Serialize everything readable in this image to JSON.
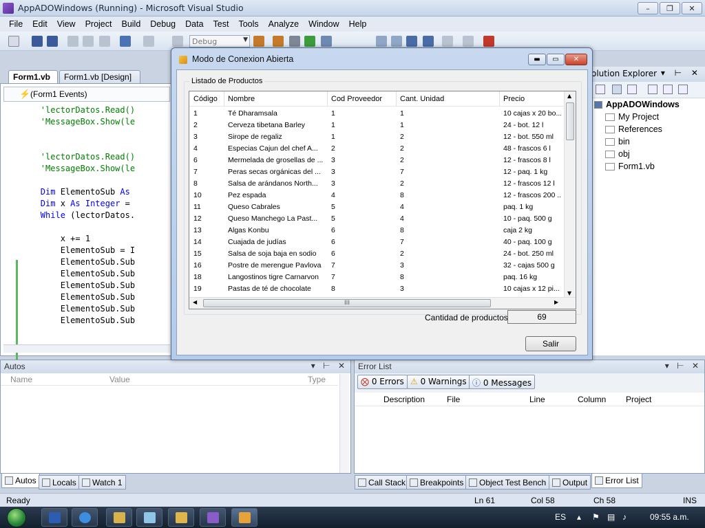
{
  "window": {
    "title": "AppADOWindows (Running) - Microsoft Visual Studio",
    "min": "–",
    "max": "❐",
    "close": "✕"
  },
  "menu": [
    "File",
    "Edit",
    "View",
    "Project",
    "Build",
    "Debug",
    "Data",
    "Test",
    "Tools",
    "Analyze",
    "Window",
    "Help"
  ],
  "toolbar": {
    "config": "Debug"
  },
  "tabs": {
    "code": "Form1.vb",
    "design": "Form1.vb [Design]"
  },
  "editor": {
    "events": "(Form1 Events)",
    "lines": [
      {
        "parts": [
          {
            "t": "        'lectorDatos.Read()",
            "c": "cmt"
          }
        ]
      },
      {
        "parts": [
          {
            "t": "        'MessageBox.Show(le",
            "c": "cmt"
          }
        ]
      },
      {
        "parts": [
          {
            "t": "",
            "c": ""
          }
        ]
      },
      {
        "parts": [
          {
            "t": "",
            "c": ""
          }
        ]
      },
      {
        "parts": [
          {
            "t": "        'lectorDatos.Read()",
            "c": "cmt"
          }
        ]
      },
      {
        "parts": [
          {
            "t": "        'MessageBox.Show(le",
            "c": "cmt"
          }
        ]
      },
      {
        "parts": [
          {
            "t": "",
            "c": ""
          }
        ]
      },
      {
        "parts": [
          {
            "t": "        ",
            "c": ""
          },
          {
            "t": "Dim",
            "c": "kw"
          },
          {
            "t": " ElementoSub ",
            "c": ""
          },
          {
            "t": "As",
            "c": "kw"
          }
        ]
      },
      {
        "parts": [
          {
            "t": "        ",
            "c": ""
          },
          {
            "t": "Dim",
            "c": "kw"
          },
          {
            "t": " x ",
            "c": ""
          },
          {
            "t": "As Integer",
            "c": "kw"
          },
          {
            "t": " =",
            "c": ""
          }
        ]
      },
      {
        "parts": [
          {
            "t": "        ",
            "c": ""
          },
          {
            "t": "While",
            "c": "kw"
          },
          {
            "t": " (lectorDatos.",
            "c": ""
          }
        ]
      },
      {
        "parts": [
          {
            "t": "",
            "c": ""
          }
        ]
      },
      {
        "parts": [
          {
            "t": "            x += 1",
            "c": ""
          }
        ]
      },
      {
        "parts": [
          {
            "t": "            ElementoSub = I",
            "c": ""
          }
        ]
      },
      {
        "parts": [
          {
            "t": "            ElementoSub.Sub",
            "c": ""
          }
        ]
      },
      {
        "parts": [
          {
            "t": "            ElementoSub.Sub",
            "c": ""
          }
        ]
      },
      {
        "parts": [
          {
            "t": "            ElementoSub.Sub",
            "c": ""
          }
        ]
      },
      {
        "parts": [
          {
            "t": "            ElementoSub.Sub",
            "c": ""
          }
        ]
      },
      {
        "parts": [
          {
            "t": "            ElementoSub.Sub",
            "c": ""
          }
        ]
      },
      {
        "parts": [
          {
            "t": "            ElementoSub.Sub",
            "c": ""
          }
        ]
      }
    ]
  },
  "solution_explorer": {
    "title": "olution Explorer",
    "project": "AppADOWindows",
    "items": [
      "My Project",
      "References",
      "bin",
      "obj",
      "Form1.vb"
    ]
  },
  "dialog": {
    "title": "Modo de Conexion Abierta",
    "group_label": "Listado de Productos",
    "columns": [
      "Código",
      "Nombre",
      "Cod Proveedor",
      "Cant. Unidad",
      "Precio"
    ],
    "rows": [
      [
        "1",
        "Té Dharamsala",
        "1",
        "1",
        "10 cajas x 20 bo..."
      ],
      [
        "2",
        "Cerveza tibetana Barley",
        "1",
        "1",
        "24 - bot. 12 l"
      ],
      [
        "3",
        "Sirope de regaliz",
        "1",
        "2",
        "12 - bot. 550 ml"
      ],
      [
        "4",
        "Especias Cajun del chef A...",
        "2",
        "2",
        "48 - frascos 6 l"
      ],
      [
        "6",
        "Mermelada de grosellas de ...",
        "3",
        "2",
        "12 - frascos 8 l"
      ],
      [
        "7",
        "Peras secas orgánicas del ...",
        "3",
        "7",
        "12 - paq. 1 kg"
      ],
      [
        "8",
        "Salsa de arándanos North...",
        "3",
        "2",
        "12 - frascos 12 l"
      ],
      [
        "10",
        "Pez espada",
        "4",
        "8",
        "12 - frascos 200 ..."
      ],
      [
        "11",
        "Queso Cabrales",
        "5",
        "4",
        "paq. 1 kg"
      ],
      [
        "12",
        "Queso Manchego La Past...",
        "5",
        "4",
        "10 - paq. 500 g"
      ],
      [
        "13",
        "Algas Konbu",
        "6",
        "8",
        "caja 2 kg"
      ],
      [
        "14",
        "Cuajada de judías",
        "6",
        "7",
        "40 - paq. 100 g"
      ],
      [
        "15",
        "Salsa de soja baja en sodio",
        "6",
        "2",
        "24 - bot. 250 ml"
      ],
      [
        "16",
        "Postre de merengue Pavlova",
        "7",
        "3",
        "32 - cajas 500 g"
      ],
      [
        "18",
        "Langostinos tigre Carnarvon",
        "7",
        "8",
        "paq. 16 kg"
      ],
      [
        "19",
        "Pastas de té de chocolate",
        "8",
        "3",
        "10 cajas x 12 pi..."
      ]
    ],
    "count_label": "Cantidad de productos:",
    "count_value": "69",
    "exit_button": "Salir",
    "hgrip": "III"
  },
  "autos": {
    "title": "Autos",
    "columns": [
      "Name",
      "Value",
      "Type"
    ]
  },
  "error_list": {
    "title": "Error List",
    "errors": "0 Errors",
    "warnings": "0 Warnings",
    "messages": "0 Messages",
    "columns": [
      "Description",
      "File",
      "Line",
      "Column",
      "Project"
    ]
  },
  "bottom_tabs_left": [
    "Autos",
    "Locals",
    "Watch 1"
  ],
  "bottom_tabs_right": [
    "Call Stack",
    "Breakpoints",
    "Object Test Bench",
    "Output",
    "Error List"
  ],
  "status": {
    "state": "Ready",
    "line": "Ln 61",
    "col": "Col 58",
    "ch": "Ch 58",
    "mode": "INS"
  },
  "taskbar": {
    "lang": "ES",
    "clock": "09:55 a.m."
  }
}
